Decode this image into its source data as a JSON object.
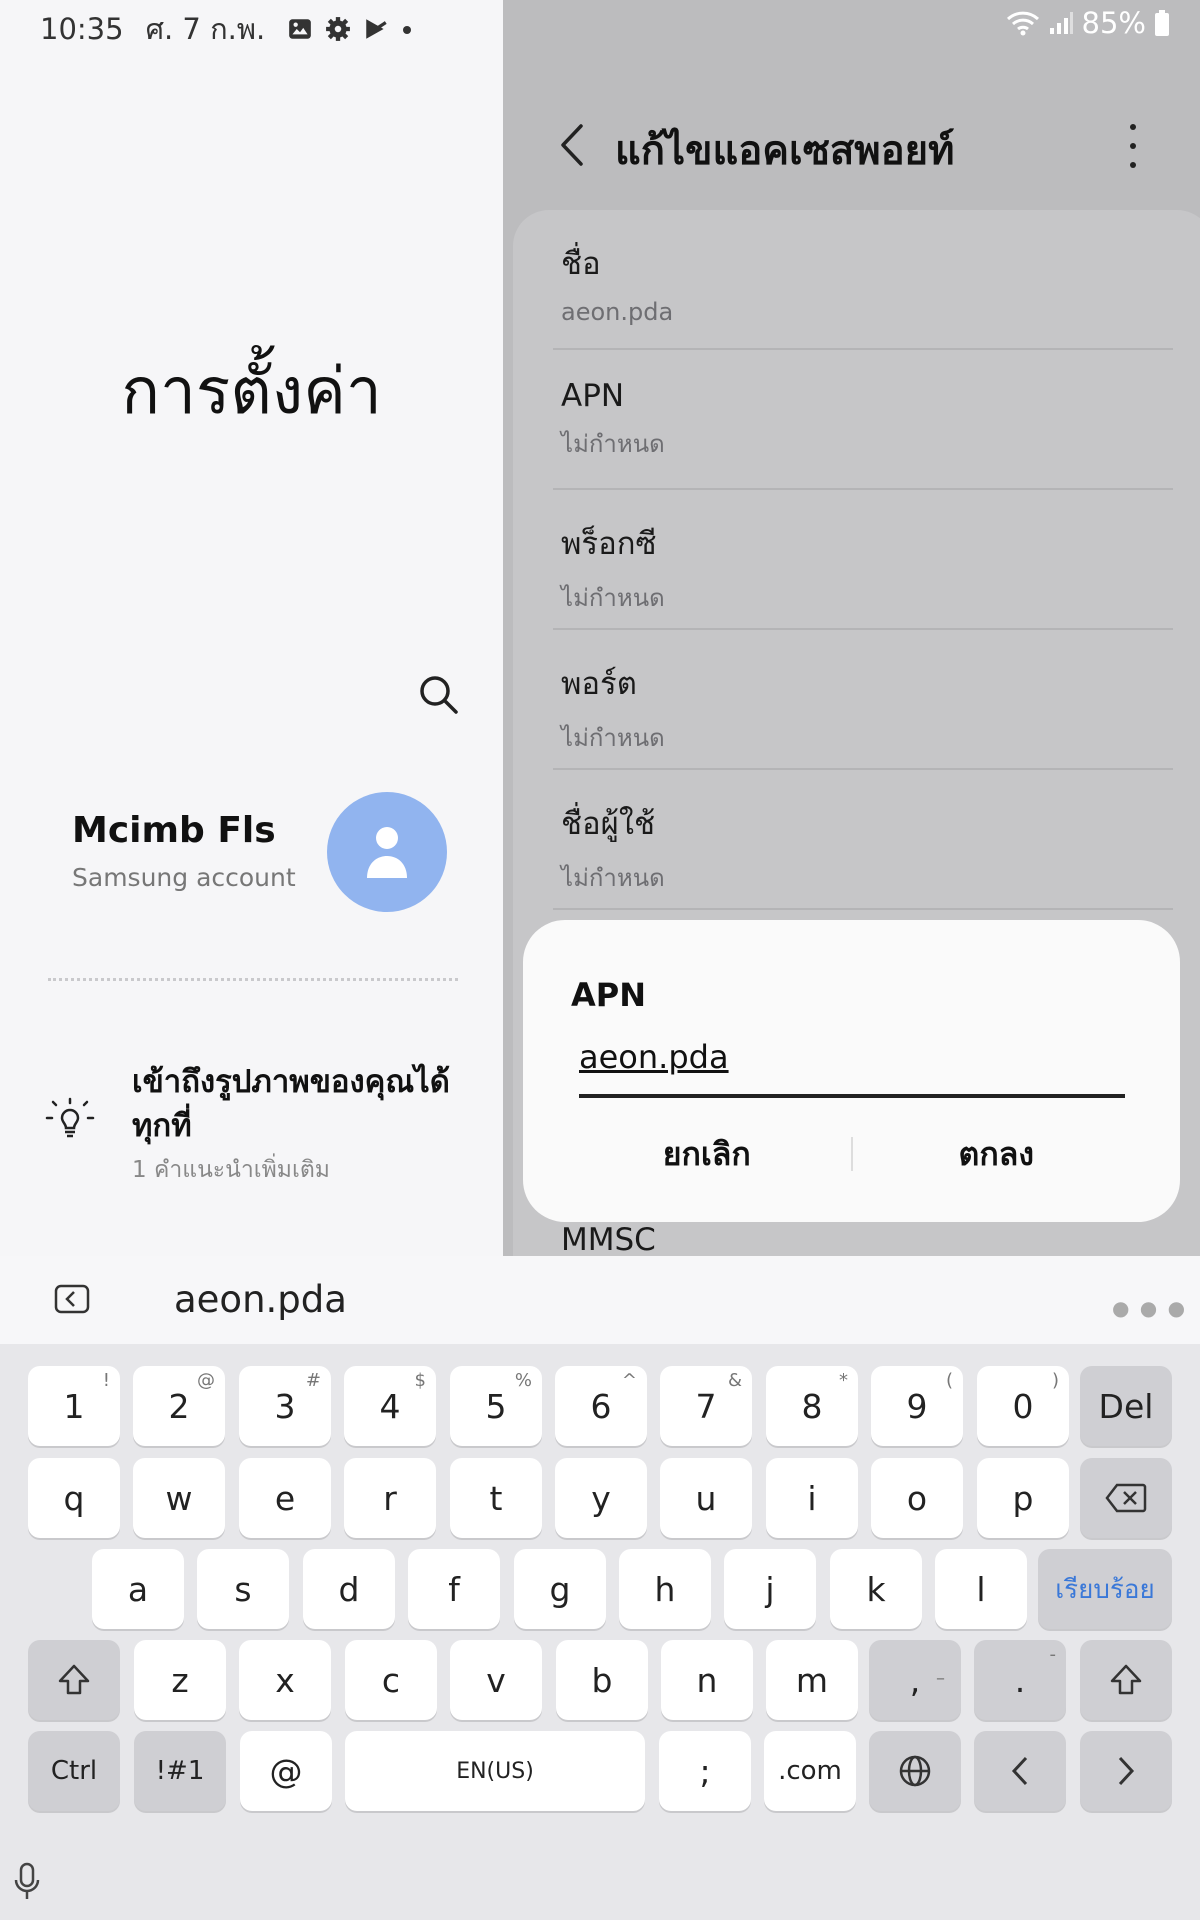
{
  "status_bar": {
    "time": "10:35",
    "date": "ศ. 7 ก.พ.",
    "battery": "85%"
  },
  "left_pane": {
    "title": "การตั้งค่า",
    "account": {
      "name": "Mcimb Fls",
      "subtitle": "Samsung account"
    },
    "suggestion": {
      "title": "เข้าถึงรูปภาพของคุณได้ทุกที่",
      "subtitle": "1 คำแนะนำเพิ่มเติม"
    }
  },
  "right_pane": {
    "title": "แก้ไขแอคเซสพอยท์",
    "items": [
      {
        "label": "ชื่อ",
        "value": "aeon.pda"
      },
      {
        "label": "APN",
        "value": "ไม่กำหนด"
      },
      {
        "label": "พร็อกซี",
        "value": "ไม่กำหนด"
      },
      {
        "label": "พอร์ต",
        "value": "ไม่กำหนด"
      },
      {
        "label": "ชื่อผู้ใช้",
        "value": "ไม่กำหนด"
      }
    ],
    "partial_item": "MMSC"
  },
  "dialog": {
    "title": "APN",
    "input_value": "aeon.pda",
    "cancel_label": "ยกเลิก",
    "ok_label": "ตกลง"
  },
  "suggestion_bar": {
    "text": "aeon.pda"
  },
  "keyboard": {
    "row1": [
      {
        "k": "1",
        "a": "!"
      },
      {
        "k": "2",
        "a": "@"
      },
      {
        "k": "3",
        "a": "#"
      },
      {
        "k": "4",
        "a": "$"
      },
      {
        "k": "5",
        "a": "%"
      },
      {
        "k": "6",
        "a": "^"
      },
      {
        "k": "7",
        "a": "&"
      },
      {
        "k": "8",
        "a": "*"
      },
      {
        "k": "9",
        "a": "("
      },
      {
        "k": "0",
        "a": ")"
      }
    ],
    "del_label": "Del",
    "row2": [
      "q",
      "w",
      "e",
      "r",
      "t",
      "y",
      "u",
      "i",
      "o",
      "p"
    ],
    "row3": [
      "a",
      "s",
      "d",
      "f",
      "g",
      "h",
      "j",
      "k",
      "l"
    ],
    "done_label": "เรียบร้อย",
    "row4": [
      "z",
      "x",
      "c",
      "v",
      "b",
      "n",
      "m"
    ],
    "comma": {
      "k": ",",
      "a": "–"
    },
    "period": {
      "k": ".",
      "a": "-"
    },
    "ctrl_label": "Ctrl",
    "symbols_label": "!#1",
    "at_label": "@",
    "space_label": "EN(US)",
    "semicolon_label": ";",
    "dotcom_label": ".com"
  },
  "colors": {
    "avatar": "#91b4ef",
    "accent": "#3a78d8",
    "dim_overlay": "#bcbcbe"
  }
}
